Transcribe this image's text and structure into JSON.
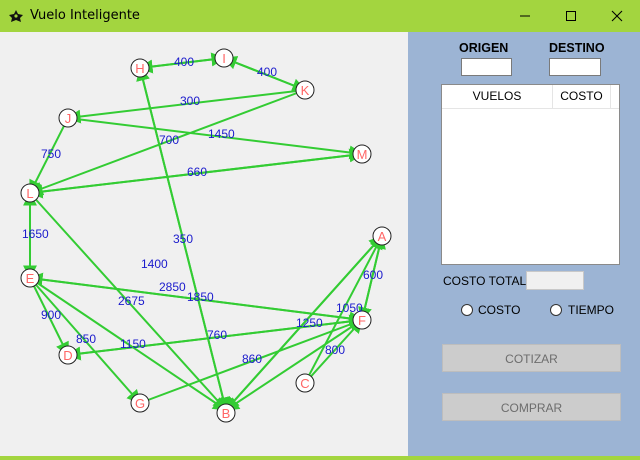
{
  "window": {
    "title": "Vuelo Inteligente",
    "accent_color": "#a3d53f",
    "panel_color": "#9cb4d4"
  },
  "graph": {
    "edge_color": "#33cc33",
    "label_color": "#1a1acc",
    "node_label_color": "#ff6666",
    "node_letters": {
      "H": "H",
      "I": "I",
      "K": "K",
      "J": "J",
      "M": "M",
      "L": "L",
      "E": "E",
      "A": "A",
      "F": "F",
      "D": "D",
      "C": "C",
      "G": "G",
      "B": "B"
    },
    "edge_labels": {
      "l400a": "400",
      "l400b": "400",
      "l300": "300",
      "l700": "700",
      "l1450": "1450",
      "l750": "750",
      "l660": "660",
      "l1650": "1650",
      "l350": "350",
      "l1400": "1400",
      "l2850": "2850",
      "l1850": "1850",
      "l2675": "2675",
      "l600": "600",
      "l1050": "1050",
      "l900": "900",
      "l1250": "1250",
      "l850": "850",
      "l1150": "1150",
      "l760": "760",
      "l800": "800",
      "l860": "860"
    }
  },
  "panel": {
    "origin_label": "ORIGEN",
    "destination_label": "DESTINO",
    "origin_value": "",
    "destination_value": "",
    "columns": [
      "VUELOS",
      "COSTO"
    ],
    "total_label": "COSTO TOTAL:",
    "total_value": "",
    "radio_cost": "COSTO",
    "radio_time": "TIEMPO",
    "quote_button": "COTIZAR",
    "buy_button": "COMPRAR"
  }
}
